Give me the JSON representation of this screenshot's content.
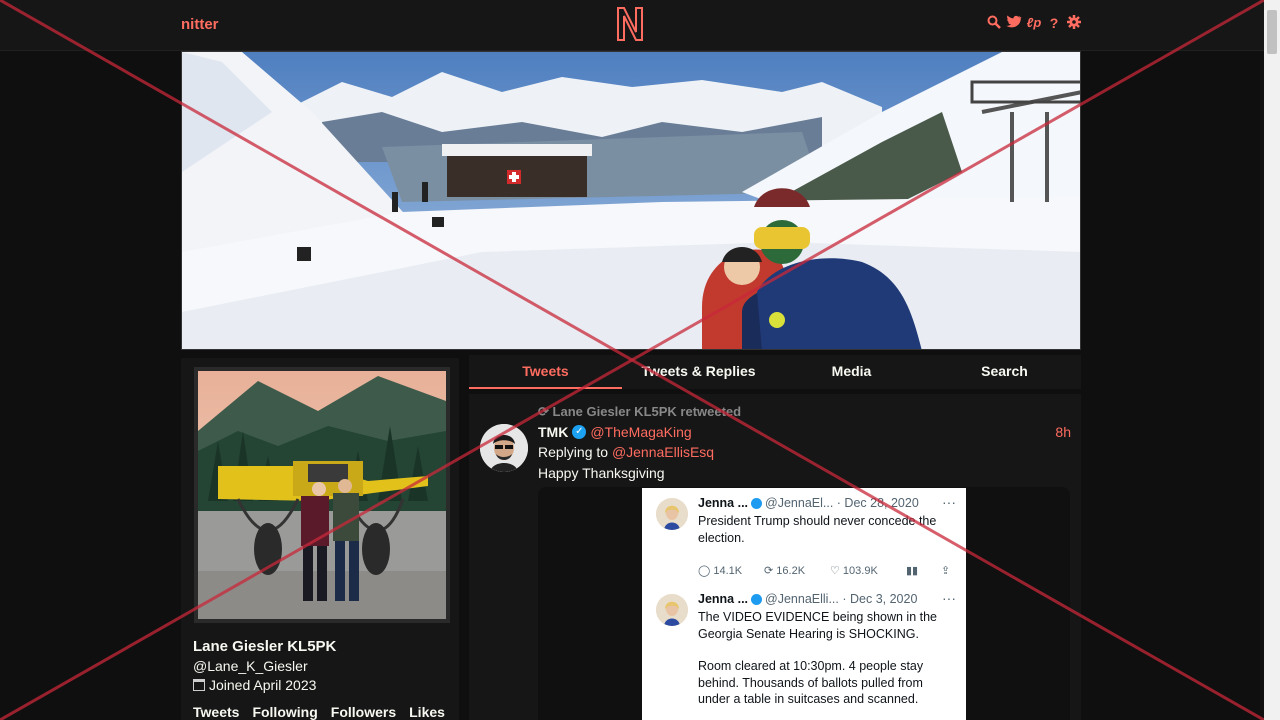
{
  "nav": {
    "brand": "nitter",
    "logo_letter": "N",
    "icons": [
      "search-icon",
      "twitter-bird-icon",
      "liberapay-icon",
      "help-icon",
      "gear-icon"
    ]
  },
  "profile": {
    "name": "Lane Giesler KL5PK",
    "handle": "@Lane_K_Giesler",
    "joined": "Joined April 2023",
    "stats": [
      "Tweets",
      "Following",
      "Followers",
      "Likes"
    ]
  },
  "tabs": [
    "Tweets",
    "Tweets & Replies",
    "Media",
    "Search"
  ],
  "active_tab": "Tweets",
  "tweet": {
    "retweet_line": "Lane Giesler KL5PK retweeted",
    "author_name": "TMK",
    "author_handle": "@TheMagaKing",
    "date": "8h",
    "replying_prefix": "Replying to",
    "replying_to": "@JennaEllisEsq",
    "text": "Happy Thanksgiving",
    "embedded": [
      {
        "name": "Jenna ...",
        "handle": "@JennaEl...",
        "date": "· Dec 28, 2020",
        "body": "President Trump should never concede the election.",
        "replies": "14.1K",
        "retweets": "16.2K",
        "likes": "103.9K"
      },
      {
        "name": "Jenna ...",
        "handle": "@JennaElli...",
        "date": "· Dec 3, 2020",
        "body": "The VIDEO EVIDENCE being shown in the Georgia Senate Hearing is SHOCKING.",
        "body2": "Room cleared at 10:30pm. 4 people stay behind. Thousands of ballots pulled from under a table in suitcases and scanned."
      }
    ]
  },
  "colors": {
    "accent": "#ff6c60",
    "background": "#0f0f0f",
    "panel": "#161616",
    "verified": "#1da1f2",
    "overlay_x": "#c8283a"
  }
}
